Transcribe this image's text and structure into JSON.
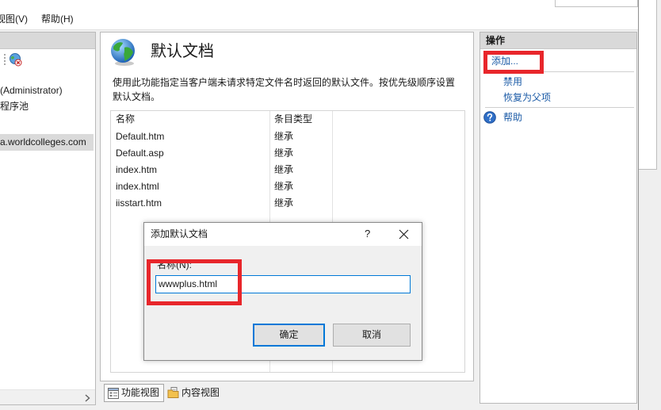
{
  "menu": {
    "items": [
      "视图(V)",
      "帮助(H)"
    ]
  },
  "connections": {
    "tree": [
      {
        "label": "(Administrator)",
        "selected": false
      },
      {
        "label": "程序池",
        "selected": false
      },
      {
        "label": "a.worldcolleges.com",
        "selected": true
      }
    ]
  },
  "feature": {
    "title": "默认文档",
    "description": [
      "使用此功能指定当客户端未请求特定文件名时返回的默认文件。按优先级顺序设置",
      "默认文档。"
    ],
    "columns": [
      "名称",
      "条目类型"
    ],
    "rows": [
      {
        "name": "Default.htm",
        "entry_type": "继承"
      },
      {
        "name": "Default.asp",
        "entry_type": "继承"
      },
      {
        "name": "index.htm",
        "entry_type": "继承"
      },
      {
        "name": "index.html",
        "entry_type": "继承"
      },
      {
        "name": "iisstart.htm",
        "entry_type": "继承"
      }
    ]
  },
  "view_tabs": [
    {
      "label": "功能视图",
      "selected": true
    },
    {
      "label": "内容视图",
      "selected": false
    }
  ],
  "actions": {
    "header": "操作",
    "items": [
      {
        "label": "添加...",
        "highlighted": true
      },
      {
        "label": "禁用"
      },
      {
        "label": "恢复为父项"
      },
      {
        "label": "帮助"
      }
    ]
  },
  "dialog": {
    "title": "添加默认文档",
    "help_button": "?",
    "name_label": "名称(N):",
    "name_value": "wwwplus.html",
    "ok_button": "确定",
    "cancel_button": "取消"
  },
  "icons": {
    "connections_toolbar": "connect-icon",
    "feature": "globe-icon",
    "help_action": "help-icon",
    "dialog_close": "close-icon",
    "scroll_right": "chevron-right-icon",
    "features_view_tab": "features-view-icon",
    "content_view_tab": "content-view-icon"
  },
  "colors": {
    "link": "#1a5aa6",
    "annotation_red": "#e8262b",
    "focus_blue": "#0078d7",
    "header_gray": "#d9d9d9",
    "selection_gray": "#dadada"
  }
}
